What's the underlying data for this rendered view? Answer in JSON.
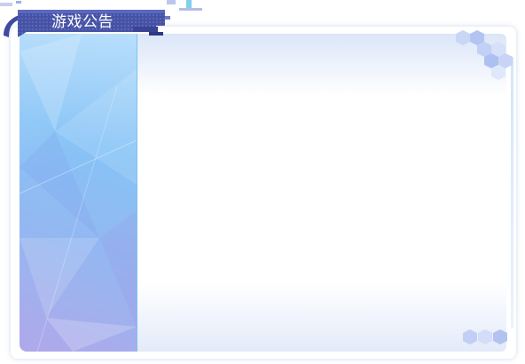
{
  "dialog": {
    "title": "游戏公告"
  },
  "colors": {
    "tab_fill": "#4a56a8",
    "tab_dark": "#3a4395",
    "sidebar_light": "#a9d7fb",
    "sidebar_mid": "#86c3f6",
    "sidebar_violet": "#b0a8ea",
    "hexagon": "#b8c8f3"
  },
  "icons": {
    "header_decoration": "tab-banner-icon",
    "corner_decoration": "hexagon-pattern-icon"
  }
}
